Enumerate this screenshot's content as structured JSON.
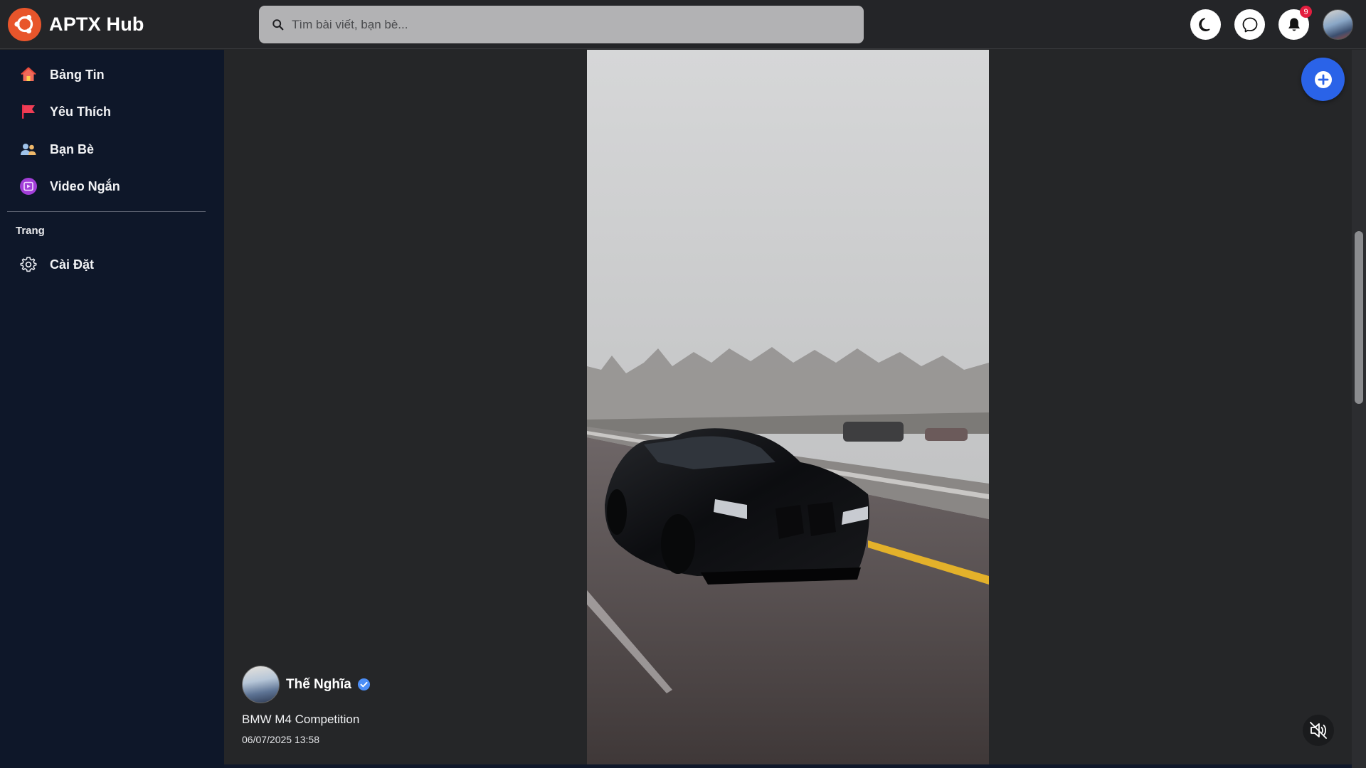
{
  "app": {
    "title": "APTX Hub"
  },
  "search": {
    "placeholder": "Tìm bài viết, bạn bè..."
  },
  "header": {
    "notification_count": "9",
    "icons": [
      "moon-icon",
      "messenger-icon",
      "bell-icon",
      "user-avatar"
    ]
  },
  "sidebar": {
    "items": [
      {
        "label": "Bảng Tin",
        "icon": "home-icon"
      },
      {
        "label": "Yêu Thích",
        "icon": "flag-icon"
      },
      {
        "label": "Bạn Bè",
        "icon": "friends-icon"
      },
      {
        "label": "Video Ngắn",
        "icon": "video-icon"
      }
    ],
    "section_label": "Trang",
    "pages": [
      {
        "label": "Cài Đặt",
        "icon": "gear-icon"
      }
    ]
  },
  "post": {
    "author": "Thế Nghĩa",
    "verified": true,
    "caption": "BMW M4 Competition",
    "timestamp": "06/07/2025 13:58",
    "muted": true
  },
  "colors": {
    "accent": "#2a63e8",
    "logo": "#e8552b",
    "sidebar_bg": "#0e1729",
    "page_bg": "#252628",
    "badge": "#e41e3f"
  }
}
